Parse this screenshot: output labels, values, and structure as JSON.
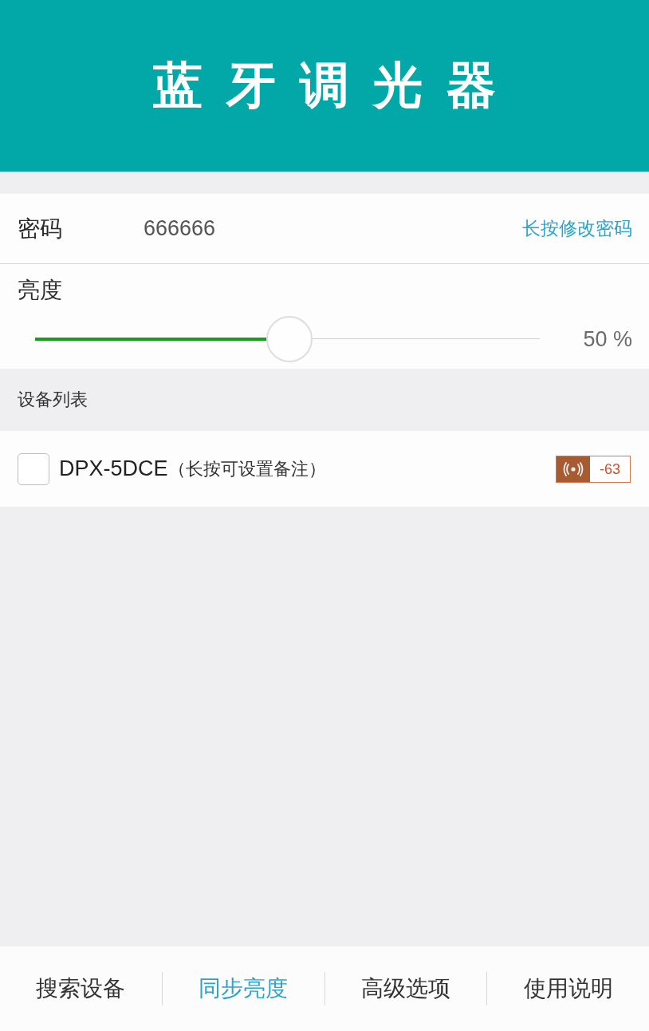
{
  "header": {
    "title": "蓝牙调光器"
  },
  "password": {
    "label": "密码",
    "value": "666666",
    "action": "长按修改密码"
  },
  "brightness": {
    "label": "亮度",
    "level": 0.5,
    "reading": "50 %"
  },
  "device_list": {
    "title": "设备列表",
    "devices": [
      {
        "name": "DPX-5DCE",
        "note": "（长按可设置备注）",
        "checked": false,
        "signal": "-63"
      }
    ]
  },
  "bottom_tabs": [
    {
      "label": "搜索设备",
      "selected": false
    },
    {
      "label": "同步亮度",
      "selected": true
    },
    {
      "label": "高级选项",
      "selected": false
    },
    {
      "label": "使用说明",
      "selected": false
    }
  ]
}
